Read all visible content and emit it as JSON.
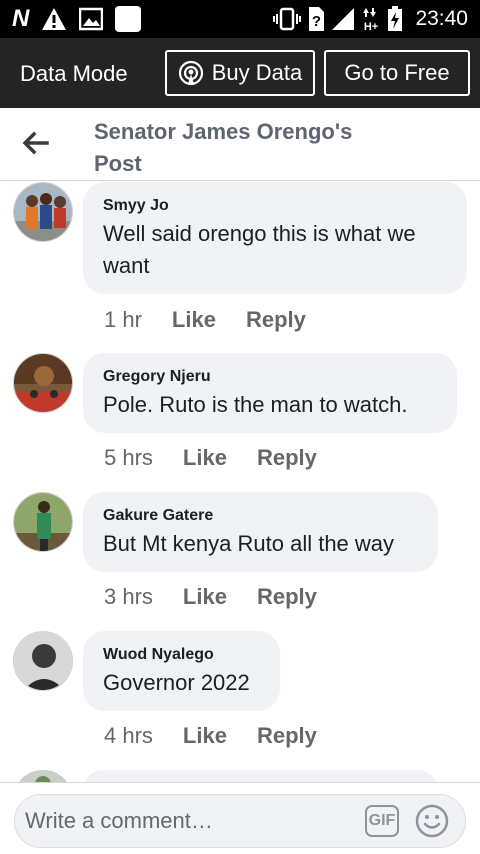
{
  "status_bar": {
    "left_letter": "N",
    "time": "23:40",
    "network_type": "H+"
  },
  "data_bar": {
    "mode_label": "Data Mode",
    "buy_data_label": "Buy Data",
    "go_free_label": "Go to Free"
  },
  "header": {
    "title_line1": "Senator James Orengo's",
    "title_line2": "Post"
  },
  "comments": [
    {
      "author": "Smyy Jo",
      "text_line1": "Well said orengo this is what we",
      "text_line2": "want",
      "time": "1 hr",
      "like": "Like",
      "reply": "Reply"
    },
    {
      "author": "Gregory Njeru",
      "text": "Pole. Ruto is the man to watch.",
      "time": "5 hrs",
      "like": "Like",
      "reply": "Reply"
    },
    {
      "author": "Gakure Gatere",
      "text": "But Mt kenya Ruto all the way",
      "time": "3 hrs",
      "like": "Like",
      "reply": "Reply"
    },
    {
      "author": "Wuod Nyalego",
      "text": "Governor 2022",
      "time": "4 hrs",
      "like": "Like",
      "reply": "Reply"
    }
  ],
  "composer": {
    "placeholder": "Write a comment…",
    "gif_label": "GIF"
  },
  "colors": {
    "data_bar_bg": "#242424",
    "title_color": "#5d6570",
    "bubble_bg": "#f0f2f5"
  }
}
